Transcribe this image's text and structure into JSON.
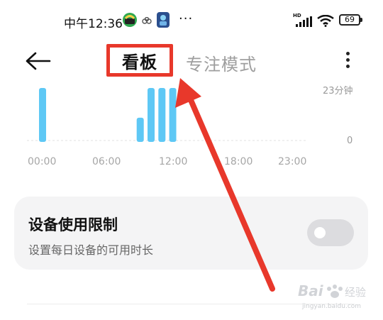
{
  "status_bar": {
    "time": "中午12:36",
    "more_dots": "···",
    "hd_label": "HD",
    "battery": "69"
  },
  "header": {
    "tabs": [
      {
        "label": "看板",
        "selected": true
      },
      {
        "label": "专注模式",
        "selected": false
      }
    ]
  },
  "chart_data": {
    "type": "bar",
    "x_ticks": [
      "00:00",
      "06:00",
      "12:00",
      "18:00",
      "23:00"
    ],
    "y_ticks": [
      "23分钟",
      "0"
    ],
    "ylim": [
      0,
      23
    ],
    "bar_color": "#5ec8f5",
    "bars": [
      {
        "hour": 0,
        "value": 23
      },
      {
        "hour": 9,
        "value": 10
      },
      {
        "hour": 10,
        "value": 23
      },
      {
        "hour": 11,
        "value": 23
      },
      {
        "hour": 12,
        "value": 23
      }
    ]
  },
  "setting_card": {
    "title": "设备使用限制",
    "subtitle": "设置每日设备的可用时长",
    "toggle_on": false
  },
  "annotation": {
    "color": "#e8382b"
  },
  "watermark": {
    "brand": "Bai",
    "suffix": "经验",
    "url": "jingyan.baidu.com"
  }
}
